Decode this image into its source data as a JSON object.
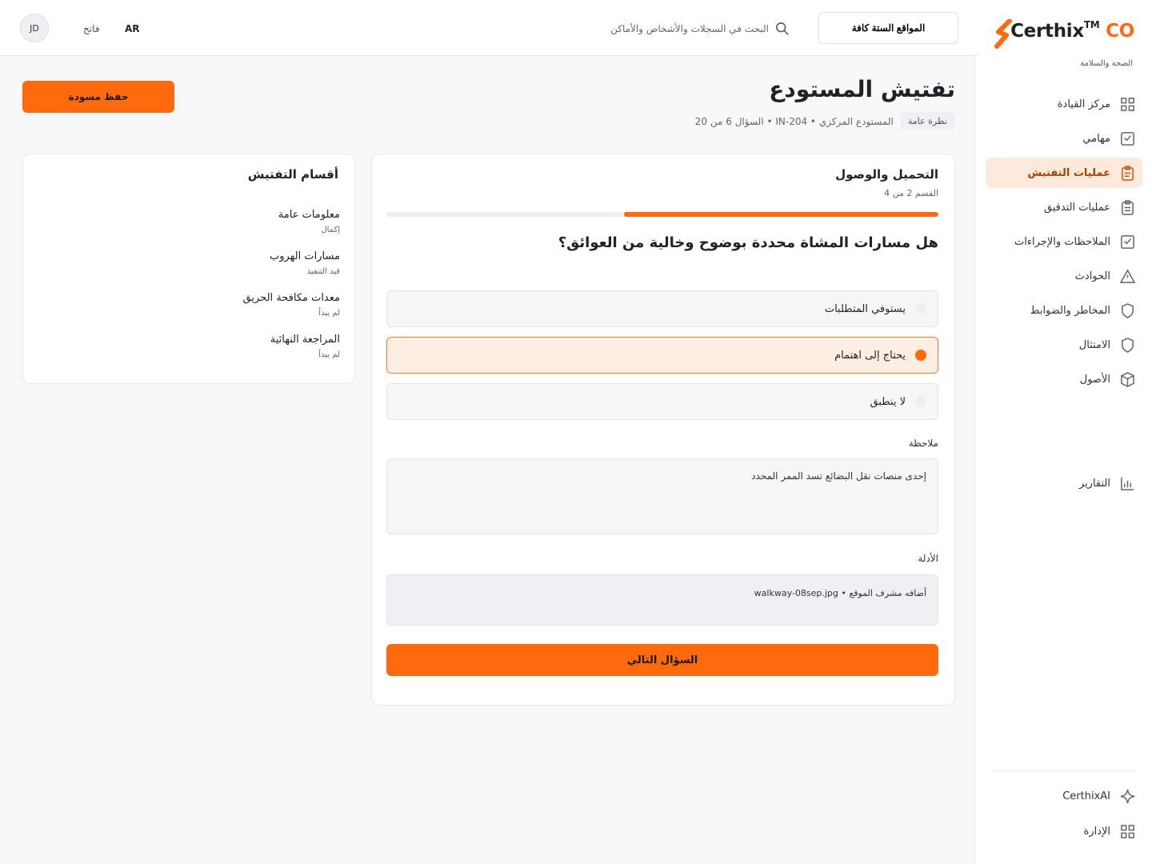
{
  "brand": {
    "name": "Certhix",
    "tm": "TM",
    "suffix": "CO",
    "subtitle": "الصحة والسلامة",
    "accent": "#ff6a0e"
  },
  "sidebar": {
    "items": [
      {
        "label": "مركز القيادة",
        "icon": "grid-icon",
        "active": false
      },
      {
        "label": "مهامي",
        "icon": "check-square-icon",
        "active": false
      },
      {
        "label": "عمليات التفتيش",
        "icon": "clipboard-icon",
        "active": true
      },
      {
        "label": "عمليات التدقيق",
        "icon": "clipboard-list-icon",
        "active": false
      },
      {
        "label": "الملاحظات والإجراءات",
        "icon": "check-square-icon",
        "active": false
      },
      {
        "label": "الحوادث",
        "icon": "warning-icon",
        "active": false
      },
      {
        "label": "المخاطر والضوابط",
        "icon": "shield-icon",
        "active": false
      },
      {
        "label": "الامتثال",
        "icon": "shield-icon",
        "active": false
      },
      {
        "label": "الأصول",
        "icon": "cube-icon",
        "active": false
      }
    ],
    "reports": {
      "label": "التقارير",
      "icon": "bar-chart-icon"
    },
    "ai": {
      "label": "CerthixAI",
      "icon": "sparkle-icon"
    },
    "admin": {
      "label": "الإدارة",
      "icon": "grid-icon"
    }
  },
  "topbar": {
    "site_selector": "المواقع الستة كافة",
    "search_placeholder": "البحث في السجلات والأشخاص والأماكن",
    "language": "AR",
    "theme": "فاتح",
    "avatar_initials": "JD"
  },
  "header": {
    "title": "تفتيش المستودع",
    "chip": "نظرة عامة",
    "meta": "المستودع المركزي • IN-204 • السؤال 6 من 20",
    "save_draft": "حفظ مسودة"
  },
  "inspection": {
    "section_title": "التحميل والوصول",
    "section_sub": "القسم 2 من 4",
    "progress": 0.57,
    "question": "هل مسارات المشاة محددة بوضوح وخالية من العوائق؟",
    "options": [
      {
        "label": "يستوفي المتطلبات",
        "selected": false
      },
      {
        "label": "يحتاج إلى اهتمام",
        "selected": true
      },
      {
        "label": "لا ينطبق",
        "selected": false
      }
    ],
    "note_label": "ملاحظة",
    "note_value": "إحدى منصات نقل البضائع تسد الممر المحدد",
    "evidence_label": "الأدلة",
    "evidence_by": "أضافه مشرف الموقع",
    "evidence_file": "walkway-08sep.jpg",
    "next_button": "السؤال التالي"
  },
  "sections": {
    "title": "أقسام التفتيش",
    "items": [
      {
        "name": "معلومات عامة",
        "status": "إكمال"
      },
      {
        "name": "مسارات الهروب",
        "status": "قيد التنفيذ"
      },
      {
        "name": "معدات مكافحة الحريق",
        "status": "لم يبدأ"
      },
      {
        "name": "المراجعة النهائية",
        "status": "لم يبدأ"
      }
    ]
  }
}
